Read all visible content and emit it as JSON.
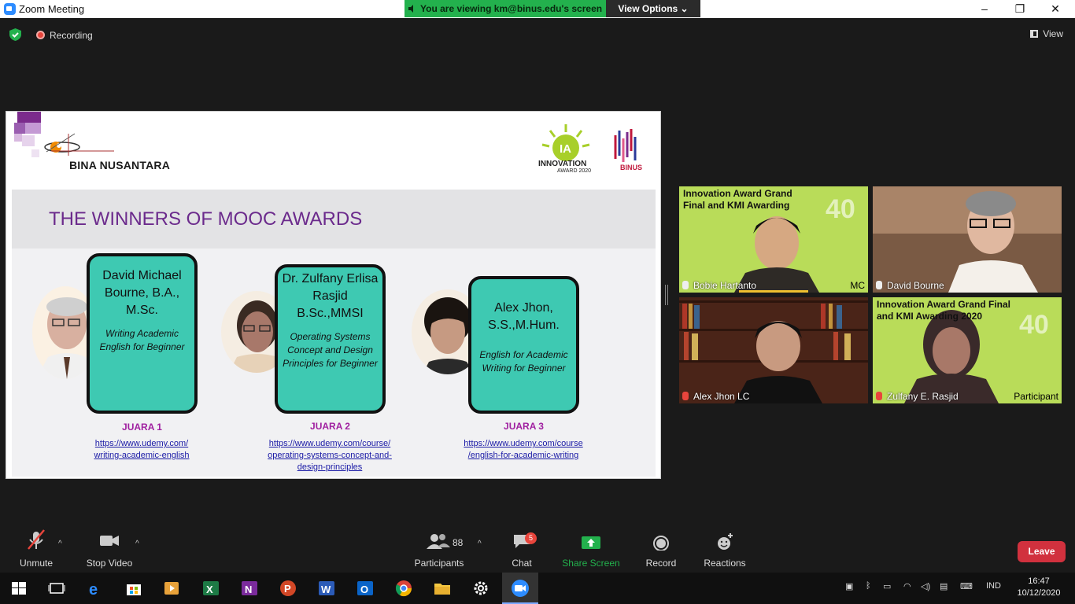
{
  "window": {
    "title": "Zoom Meeting",
    "minimize": "–",
    "restore": "❐",
    "close": "✕"
  },
  "banner": {
    "viewing": "You are viewing km@binus.edu's screen",
    "view_options": "View Options ⌄"
  },
  "topbar": {
    "recording": "Recording",
    "view": "View"
  },
  "slide": {
    "org_name": "BINA NUSANTARA",
    "innovation_logo": "INNOVATION",
    "innovation_year": "AWARD 2020",
    "binus_logo": "BINUS",
    "title": "THE WINNERS OF MOOC AWARDS",
    "winners": [
      {
        "name": "David Michael Bourne, B.A., M.Sc.",
        "course": "Writing Academic English for Beginner",
        "rank": "JUARA 1",
        "link1": "https://www.udemy.com/",
        "link2": "writing-academic-english",
        "link3": ""
      },
      {
        "name": "Dr. Zulfany Erlisa Rasjid B.Sc.,MMSI",
        "course": "Operating Systems Concept and Design Principles for Beginner",
        "rank": "JUARA 2",
        "link1": "https://www.udemy.com/course/",
        "link2": "operating-systems-concept-and-",
        "link3": "design-principles"
      },
      {
        "name": "Alex Jhon, S.S.,M.Hum.",
        "course": "English for Academic Writing for Beginner",
        "rank": "JUARA 3",
        "link1": "https://www.udemy.com/course",
        "link2": "/english-for-academic-writing ",
        "link3": ""
      }
    ]
  },
  "gallery": [
    {
      "name": "Bobie Hartanto",
      "overlay": "Innovation Award Grand Final and KMI Awarding",
      "role": "MC",
      "bg": "#b9dc59"
    },
    {
      "name": "David Bourne",
      "overlay": "",
      "role": "",
      "bg": "#8a6e58"
    },
    {
      "name": "Alex Jhon LC",
      "overlay": "",
      "role": "",
      "bg": "#6a3a2a"
    },
    {
      "name": "Zulfany E. Rasjid",
      "overlay": "Innovation Award Grand Final and KMI Awarding 2020",
      "role": "Participant",
      "bg": "#b9dc59"
    }
  ],
  "toolbar": {
    "unmute": "Unmute",
    "stop_video": "Stop Video",
    "participants": "Participants",
    "participants_count": "88",
    "chat": "Chat",
    "chat_badge": "5",
    "share_screen": "Share Screen",
    "record": "Record",
    "reactions": "Reactions",
    "leave": "Leave"
  },
  "taskbar": {
    "lang": "IND",
    "time": "16:47",
    "date": "10/12/2020"
  },
  "colors": {
    "accent_green": "#23b14d",
    "slide_purple": "#6b2a8c",
    "card_teal": "#3ec9b2",
    "leave_red": "#d1313e"
  }
}
